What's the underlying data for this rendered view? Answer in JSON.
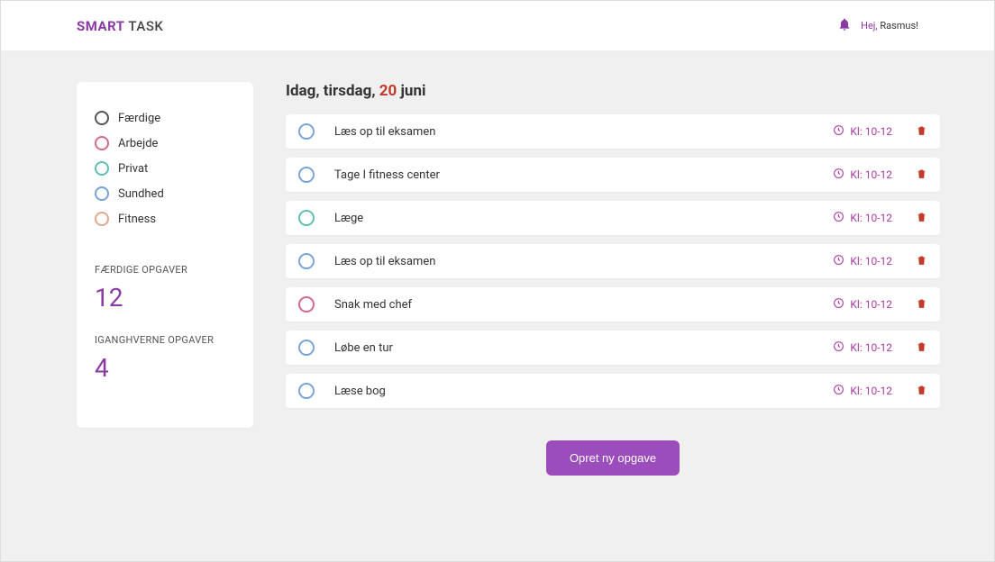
{
  "header": {
    "logo_strong": "SMART",
    "logo_light": " TASK",
    "greeting_prefix": "Hej, ",
    "greeting_name": "Rasmus!"
  },
  "sidebar": {
    "categories": [
      {
        "label": "Færdige",
        "color": "#555"
      },
      {
        "label": "Arbejde",
        "color": "#d46a8e"
      },
      {
        "label": "Privat",
        "color": "#5fbfb0"
      },
      {
        "label": "Sundhed",
        "color": "#7aa3d6"
      },
      {
        "label": "Fitness",
        "color": "#e0a98e"
      }
    ],
    "stats": [
      {
        "label": "FÆRDIGE OPGAVER",
        "value": "12"
      },
      {
        "label": "IGANGHVERNE OPGAVER",
        "value": "4"
      }
    ]
  },
  "main": {
    "date_prefix": "Idag, tirsdag, ",
    "date_num": "20",
    "date_suffix": " juni",
    "tasks": [
      {
        "title": "Læs op til eksamen",
        "time": "Kl: 10-12",
        "color": "#7aa3d6"
      },
      {
        "title": "Tage I fitness center",
        "time": "Kl: 10-12",
        "color": "#7aa3d6"
      },
      {
        "title": "Læge",
        "time": "Kl: 10-12",
        "color": "#5fbfb0"
      },
      {
        "title": "Læs op til eksamen",
        "time": "Kl: 10-12",
        "color": "#7aa3d6"
      },
      {
        "title": "Snak med chef",
        "time": "Kl: 10-12",
        "color": "#d46a8e"
      },
      {
        "title": "Løbe en tur",
        "time": "Kl: 10-12",
        "color": "#7aa3d6"
      },
      {
        "title": "Læse bog",
        "time": "Kl: 10-12",
        "color": "#7aa3d6"
      }
    ],
    "create_label": "Opret ny opgave"
  }
}
